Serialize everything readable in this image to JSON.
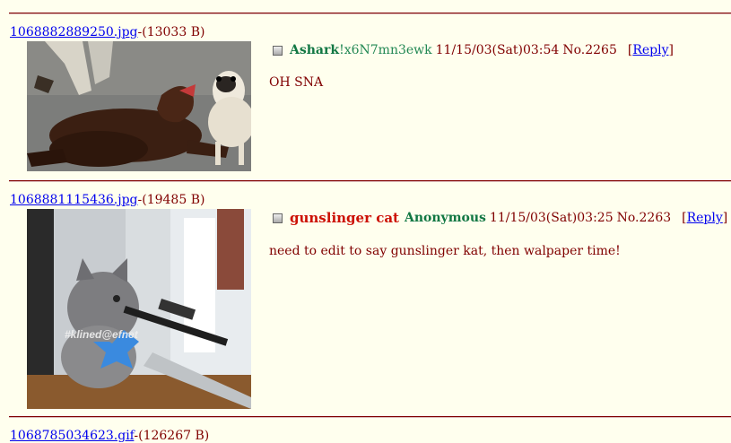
{
  "posts": [
    {
      "file_name": "1068882889250.jpg",
      "file_size": "-(13033 B)",
      "subject": "",
      "name": "Ashark",
      "trip": "!x6N7mn3ewk",
      "datetime": "11/15/03(Sat)03:54",
      "number": "No.2265",
      "reply_label": "Reply",
      "message": "OH SNA"
    },
    {
      "file_name": "1068881115436.jpg",
      "file_size": "-(19485 B)",
      "subject": "gunslinger cat",
      "name": "Anonymous",
      "trip": "",
      "datetime": "11/15/03(Sat)03:25",
      "number": "No.2263",
      "reply_label": "Reply",
      "message": "need to edit to say gunslinger kat, then walpaper time!",
      "watermark": "#klined@efnet"
    },
    {
      "file_name": "1068785034623.gif",
      "file_size": "-(126267 B)"
    }
  ]
}
